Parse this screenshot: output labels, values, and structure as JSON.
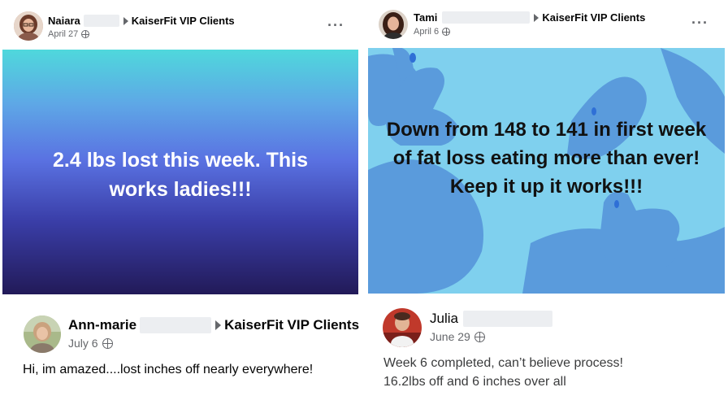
{
  "post1": {
    "author": "Naiara",
    "group": "KaiserFit VIP Clients",
    "date": "April 27",
    "body": "2.4 lbs lost this week. This works ladies!!!"
  },
  "post2": {
    "author": "Tami",
    "group": "KaiserFit VIP Clients",
    "date": "April 6",
    "body": "Down from 148 to 141 in first week of fat loss eating more than ever! Keep it up it works!!!"
  },
  "post3": {
    "author": "Ann-marie",
    "group": "KaiserFit VIP Clients",
    "date": "July 6",
    "body": "Hi, im amazed....lost inches off nearly everywhere!"
  },
  "post4": {
    "author": "Julia",
    "date": "June 29",
    "body_line1": "Week 6 completed, can’t believe process!",
    "body_line2": "16.2lbs off and 6 inches over all"
  },
  "icons": {
    "more": "more-options-icon",
    "audience": "globe-icon"
  },
  "colors": {
    "meta": "#65676b",
    "gradient_top": "#4fd8dc",
    "gradient_bottom": "#221a58",
    "blue_bg": "#7fd0ee",
    "shape": "#5a9bdc"
  }
}
